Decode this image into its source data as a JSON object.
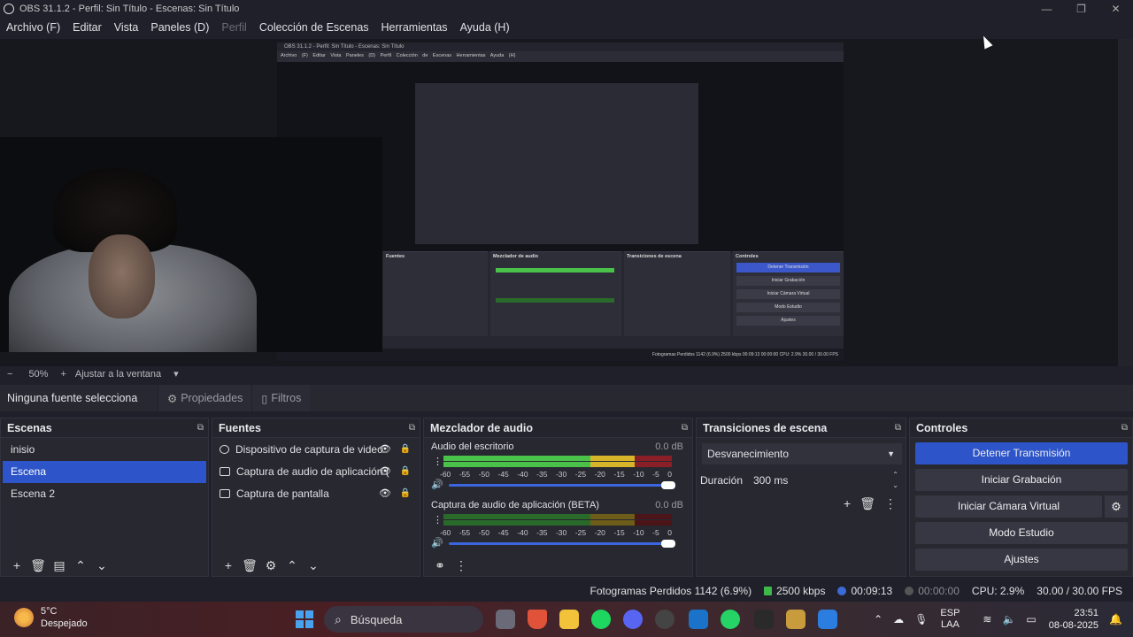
{
  "window": {
    "title": "OBS 31.1.2 - Perfil: Sin Título - Escenas: Sin Título",
    "minimize": "—",
    "maximize": "❐",
    "close": "✕"
  },
  "menu": [
    "Archivo (F)",
    "Editar",
    "Vista",
    "Paneles (D)",
    "Perfil",
    "Colección de Escenas",
    "Herramientas",
    "Ayuda (H)"
  ],
  "nested": {
    "title": "OBS 31.1.2 - Perfil: Sin Título - Escenas: Sin Título",
    "menu": "Archivo (F)  Editar  Vista  Paneles (D)  Perfil  Colección de Escenas  Herramientas  Ayuda (H)",
    "fuentes": "Fuentes",
    "mezclador": "Mezclador de audio",
    "transiciones": "Transiciones de escena",
    "controles": "Controles",
    "detener": "Detener Transmisión",
    "grabacion": "Iniciar Grabación",
    "camara": "Iniciar Cámara Virtual",
    "estudio": "Modo Estudio",
    "ajustes": "Ajustes",
    "status": "Fotogramas Perdidos 1142 (6.9%)   2500 kbps   00:09:13   00:00:00   CPU: 2.9%   30.00 / 30.00 FPS"
  },
  "zoom": {
    "minus": "−",
    "value": "50%",
    "plus": "+",
    "fit": "Ajustar a la ventana",
    "arrow": "▾"
  },
  "source_bar": {
    "none": "Ninguna fuente selecciona",
    "properties": "Propiedades",
    "filters": "Filtros"
  },
  "scenes": {
    "header": "Escenas",
    "items": [
      "inisio",
      "Escena",
      "Escena 2"
    ],
    "selected_index": 1
  },
  "sources": {
    "header": "Fuentes",
    "items": [
      "Dispositivo de captura de video",
      "Captura de audio de aplicación (",
      "Captura de pantalla"
    ]
  },
  "mixer": {
    "header": "Mezclador de audio",
    "channels": [
      {
        "name": "Audio del escritorio",
        "db": "0.0 dB"
      },
      {
        "name": "Captura de audio de aplicación (BETA)",
        "db": "0.0 dB"
      }
    ],
    "scale": [
      "-60",
      "-55",
      "-50",
      "-45",
      "-40",
      "-35",
      "-30",
      "-25",
      "-20",
      "-15",
      "-10",
      "-5",
      "0"
    ]
  },
  "transitions": {
    "header": "Transiciones de escena",
    "selected": "Desvanecimiento",
    "duration_label": "Duración",
    "duration_value": "300 ms"
  },
  "controls": {
    "header": "Controles",
    "stop_stream": "Detener Transmisión",
    "start_recording": "Iniciar Grabación",
    "start_virtual_cam": "Iniciar Cámara Virtual",
    "studio_mode": "Modo Estudio",
    "settings": "Ajustes"
  },
  "status": {
    "dropped": "Fotogramas Perdidos 1142 (6.9%)",
    "bitrate": "2500 kbps",
    "stream_time": "00:09:13",
    "rec_time": "00:00:00",
    "cpu": "CPU: 2.9%",
    "fps": "30.00 / 30.00 FPS"
  },
  "taskbar": {
    "temp": "5°C",
    "weather": "Despejado",
    "search": "Búsqueda",
    "lang1": "ESP",
    "lang2": "LAA",
    "time": "23:51",
    "date": "08-08-2025"
  },
  "colors": {
    "accent": "#2d54c8",
    "meter_green": "#4ac24a",
    "meter_yellow": "#d6b52a",
    "meter_red": "#8a1f28"
  }
}
